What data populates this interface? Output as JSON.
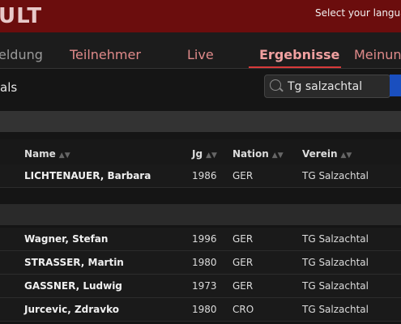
{
  "header": {
    "brand_fragment": "ULT",
    "language_prompt": "Select your languag"
  },
  "nav": {
    "items": [
      "eldung",
      "Teilnehmer",
      "Live",
      "Ergebnisse",
      "Meinun"
    ],
    "active": "Ergebnisse"
  },
  "filter": {
    "label": "als",
    "search_value": "Tg salzachtal"
  },
  "table_columns": {
    "name": "Name",
    "jg": "Jg",
    "nation": "Nation",
    "verein": "Verein"
  },
  "groups": [
    {
      "rows": [
        {
          "name": "LICHTENAUER, Barbara",
          "jg": "1986",
          "nation": "GER",
          "verein": "TG Salzachtal"
        }
      ]
    },
    {
      "rows": [
        {
          "name": "Wagner, Stefan",
          "jg": "1996",
          "nation": "GER",
          "verein": "TG Salzachtal"
        },
        {
          "name": "STRASSER, Martin",
          "jg": "1980",
          "nation": "GER",
          "verein": "TG Salzachtal"
        },
        {
          "name": "GASSNER, Ludwig",
          "jg": "1973",
          "nation": "GER",
          "verein": "TG Salzachtal"
        },
        {
          "name": "Jurcevic, Zdravko",
          "jg": "1980",
          "nation": "CRO",
          "verein": "TG Salzachtal"
        }
      ]
    }
  ],
  "colors": {
    "top_bar": "#6b0d0d",
    "accent_underline": "#d83a3a",
    "nav_text": "#e08a8a",
    "search_button": "#1a4fbf"
  }
}
